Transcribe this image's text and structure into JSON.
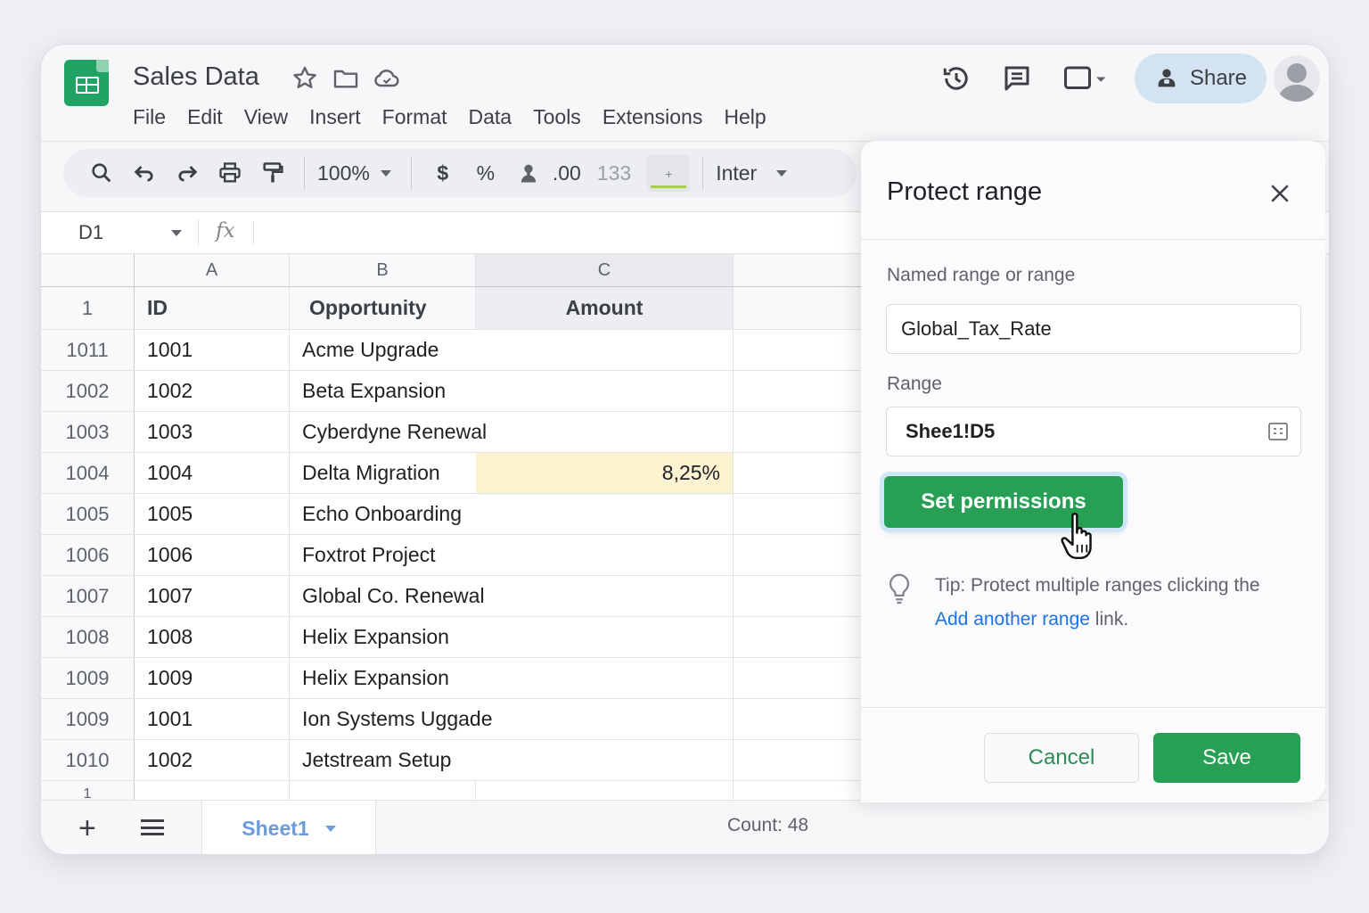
{
  "app": {
    "doc_title": "Sales Data",
    "menu": [
      "File",
      "Edit",
      "View",
      "Insert",
      "Format",
      "Data",
      "Tools",
      "Extensions",
      "Help"
    ],
    "share_label": "Share"
  },
  "toolbar": {
    "zoom": "100%",
    "currency": "$",
    "percent": "%",
    "decimal": ".00",
    "number_format": "133",
    "font": "Inter"
  },
  "formula_bar": {
    "cell_ref": "D1",
    "fx_label": "fx"
  },
  "sheet": {
    "columns": [
      "A",
      "B",
      "C"
    ],
    "header_row": {
      "row_num": "1",
      "id": "ID",
      "opportunity": "Opportunity",
      "amount": "Amount"
    },
    "rows": [
      {
        "row_num": "1011",
        "id": "1001",
        "opportunity": "Acme Upgrade",
        "amount": ""
      },
      {
        "row_num": "1002",
        "id": "1002",
        "opportunity": "Beta Expansion",
        "amount": ""
      },
      {
        "row_num": "1003",
        "id": "1003",
        "opportunity": "Cyberdyne Renewal",
        "amount": ""
      },
      {
        "row_num": "1004",
        "id": "1004",
        "opportunity": "Delta Migration",
        "amount": "8,25%"
      },
      {
        "row_num": "1005",
        "id": "1005",
        "opportunity": "Echo Onboarding",
        "amount": ""
      },
      {
        "row_num": "1006",
        "id": "1006",
        "opportunity": "Foxtrot Project",
        "amount": ""
      },
      {
        "row_num": "1007",
        "id": "1007",
        "opportunity": "Global Co. Renewal",
        "amount": ""
      },
      {
        "row_num": "1008",
        "id": "1008",
        "opportunity": "Helix Expansion",
        "amount": ""
      },
      {
        "row_num": "1009",
        "id": "1009",
        "opportunity": "Helix Expansion",
        "amount": ""
      },
      {
        "row_num": "1009",
        "id": "1001",
        "opportunity": "Ion Systems Uggade",
        "amount": ""
      },
      {
        "row_num": "1010",
        "id": "1002",
        "opportunity": "Jetstream Setup",
        "amount": ""
      }
    ],
    "partial_row_num": "1"
  },
  "bottom_bar": {
    "sheet_tab": "Sheet1",
    "count": "Count: 48"
  },
  "panel": {
    "title": "Protect range",
    "named_range_label": "Named range or range",
    "named_range_value": "Global_Tax_Rate",
    "range_label": "Range",
    "range_value": "Shee1!D5",
    "set_permissions_label": "Set permissions",
    "tip_text": "Tip: Protect multiple ranges clicking the",
    "tip_link": "Add another range",
    "tip_suffix": " link.",
    "cancel_label": "Cancel",
    "save_label": "Save"
  }
}
